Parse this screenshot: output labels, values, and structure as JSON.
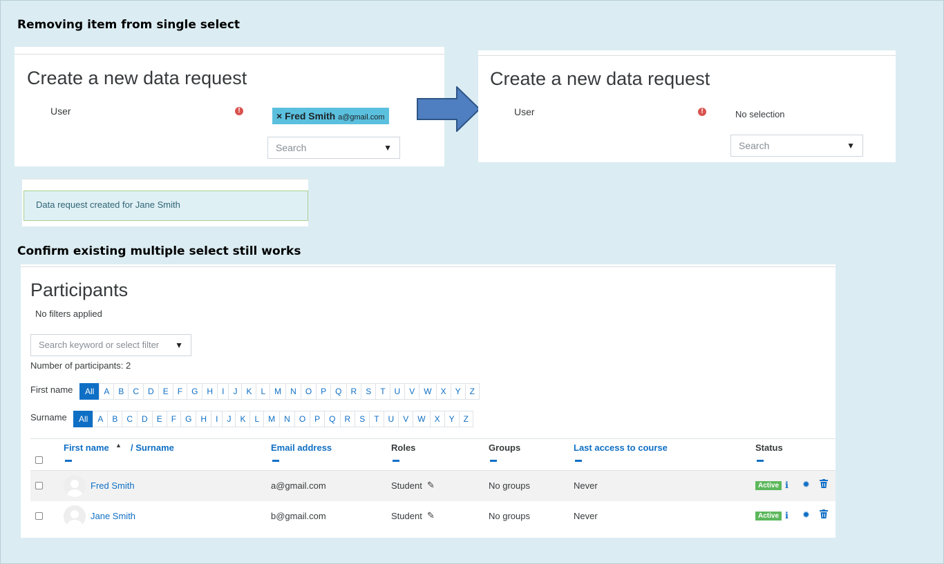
{
  "headings": {
    "removing": "Removing item from single select",
    "confirm": "Confirm existing multiple select still works"
  },
  "form_before": {
    "title": "Create a new data request",
    "user_label": "User",
    "selected_name": "Fred Smith",
    "selected_email": "a@gmail.com",
    "remove_glyph": "×",
    "search_placeholder": "Search"
  },
  "form_after": {
    "title": "Create a new data request",
    "user_label": "User",
    "no_selection": "No selection",
    "search_placeholder": "Search"
  },
  "alert": {
    "text": "Data request created for Jane Smith"
  },
  "participants": {
    "title": "Participants",
    "filters_status": "No filters applied",
    "search_placeholder": "Search keyword or select filter",
    "count_text": "Number of participants: 2",
    "first_name_label": "First name",
    "surname_label": "Surname",
    "letters": [
      "All",
      "A",
      "B",
      "C",
      "D",
      "E",
      "F",
      "G",
      "H",
      "I",
      "J",
      "K",
      "L",
      "M",
      "N",
      "O",
      "P",
      "Q",
      "R",
      "S",
      "T",
      "U",
      "V",
      "W",
      "X",
      "Y",
      "Z"
    ],
    "columns": {
      "first_name": "First name",
      "surname": "/ Surname",
      "email": "Email address",
      "roles": "Roles",
      "groups": "Groups",
      "last_access": "Last access to course",
      "status": "Status"
    },
    "rows": [
      {
        "name": "Fred Smith",
        "email": "a@gmail.com",
        "role": "Student",
        "groups": "No groups",
        "last_access": "Never",
        "status": "Active"
      },
      {
        "name": "Jane Smith",
        "email": "b@gmail.com",
        "role": "Student",
        "groups": "No groups",
        "last_access": "Never",
        "status": "Active"
      }
    ]
  },
  "colors": {
    "background": "#dbedf3",
    "link": "#0f6fc5",
    "tag": "#5bc0de",
    "arrow": "#4f7fc0",
    "badge": "#5cb85c",
    "required": "#d9534f"
  }
}
